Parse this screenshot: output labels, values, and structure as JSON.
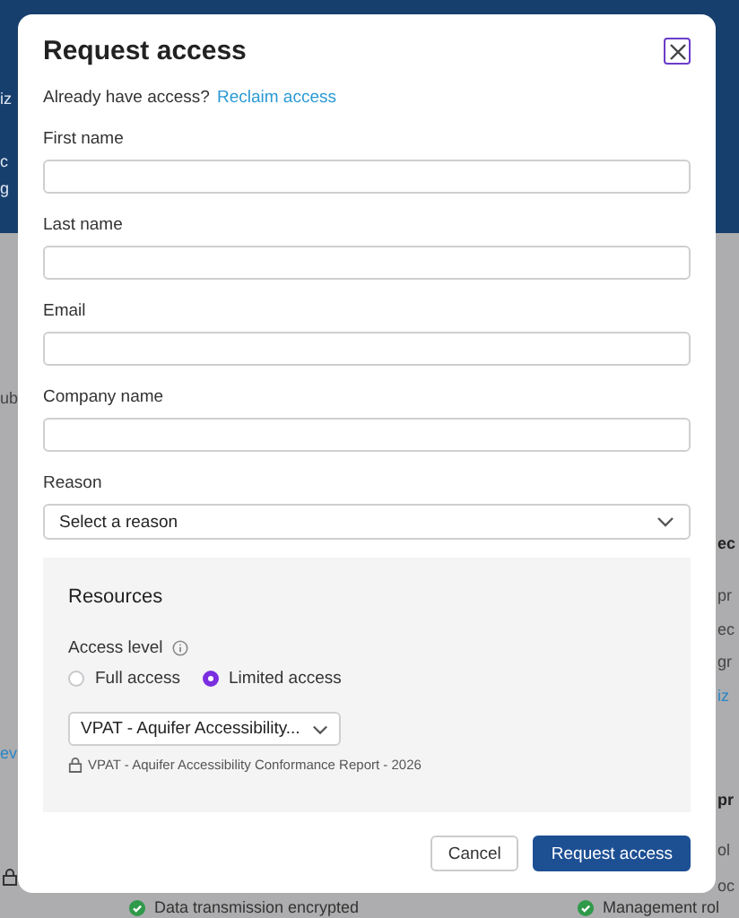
{
  "background_page": {
    "left_fragments": [
      {
        "text": "iz",
        "kind": "light"
      },
      {
        "text": "c",
        "kind": "light"
      },
      {
        "text": "g",
        "kind": "light"
      },
      {
        "text": "ub",
        "kind": "text"
      },
      {
        "text": "ev",
        "kind": "link"
      }
    ],
    "right_fragments": [
      {
        "text": "ec",
        "kind": "heading"
      },
      {
        "text": "pr",
        "kind": "text"
      },
      {
        "text": "ec",
        "kind": "text"
      },
      {
        "text": "gr",
        "kind": "text"
      },
      {
        "text": "iz",
        "kind": "link"
      },
      {
        "text": "pr",
        "kind": "heading"
      },
      {
        "text": "ol",
        "kind": "text"
      },
      {
        "text": "oc",
        "kind": "text"
      }
    ],
    "bottom_items": [
      "Data transmission encrypted",
      "Management rol"
    ]
  },
  "dialog": {
    "title": "Request access",
    "intro": {
      "text": "Already have access?",
      "link": "Reclaim access"
    },
    "fields": [
      {
        "label": "First name",
        "kind": "text"
      },
      {
        "label": "Last name",
        "kind": "text"
      },
      {
        "label": "Email",
        "kind": "text"
      },
      {
        "label": "Company name",
        "kind": "text"
      },
      {
        "label": "Reason",
        "kind": "select",
        "placeholder": "Select a reason"
      }
    ],
    "resources": {
      "title": "Resources",
      "access_level_label": "Access level",
      "options": [
        {
          "label": "Full access",
          "selected": false
        },
        {
          "label": "Limited access",
          "selected": true
        }
      ],
      "resource_select": "VPAT - Aquifer Accessibility...",
      "resource_note": "VPAT - Aquifer Accessibility Conformance Report - 2026"
    },
    "buttons": [
      {
        "label": "Cancel",
        "kind": "secondary"
      },
      {
        "label": "Request access",
        "kind": "primary"
      }
    ]
  }
}
